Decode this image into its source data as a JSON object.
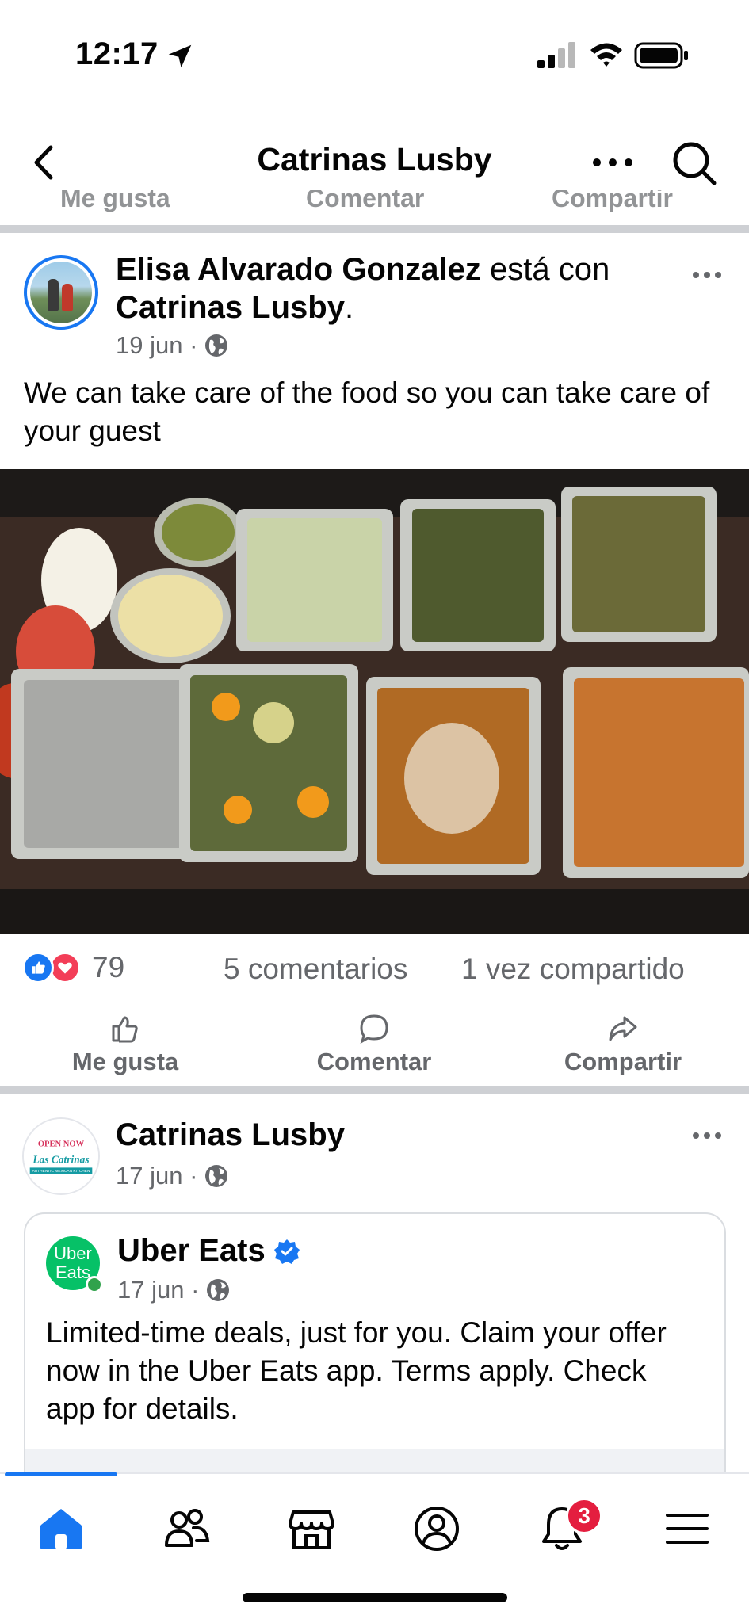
{
  "status_bar": {
    "time": "12:17"
  },
  "header": {
    "title": "Catrinas Lusby"
  },
  "ghost_actions": [
    "Me gusta",
    "Comentar",
    "Compartir"
  ],
  "post": {
    "author": "Elisa Alvarado Gonzalez",
    "with_text": " está con ",
    "tagged_page": "Catrinas Lusby",
    "tag_suffix": ".",
    "date": "19 jun ·",
    "text": "We can take care of the food so you can take care of your guest",
    "reaction_count": "79",
    "comments": "5 comentarios",
    "shares": "1 vez compartido",
    "actions": {
      "like": "Me gusta",
      "comment": "Comentar",
      "share": "Compartir"
    }
  },
  "post2": {
    "author": "Catrinas Lusby",
    "date": "17 jun ·",
    "avatar_text": {
      "top": "OPEN NOW",
      "brand": "Las Catrinas",
      "sub": "AUTHENTIC MEXICAN KITCHEN"
    },
    "shared": {
      "author": "Uber Eats",
      "avatar_line1": "Uber",
      "avatar_line2": "Eats",
      "date": "17 jun ·",
      "text": "Limited-time deals, just for you. Claim your offer now in the Uber Eats app. Terms apply. Check app for details."
    }
  },
  "tab_bar": {
    "notification_badge": "3"
  },
  "colors": {
    "accent": "#1877f2",
    "secondary_text": "#65676b",
    "badge": "#e41e3f",
    "uber_green": "#06c167"
  }
}
